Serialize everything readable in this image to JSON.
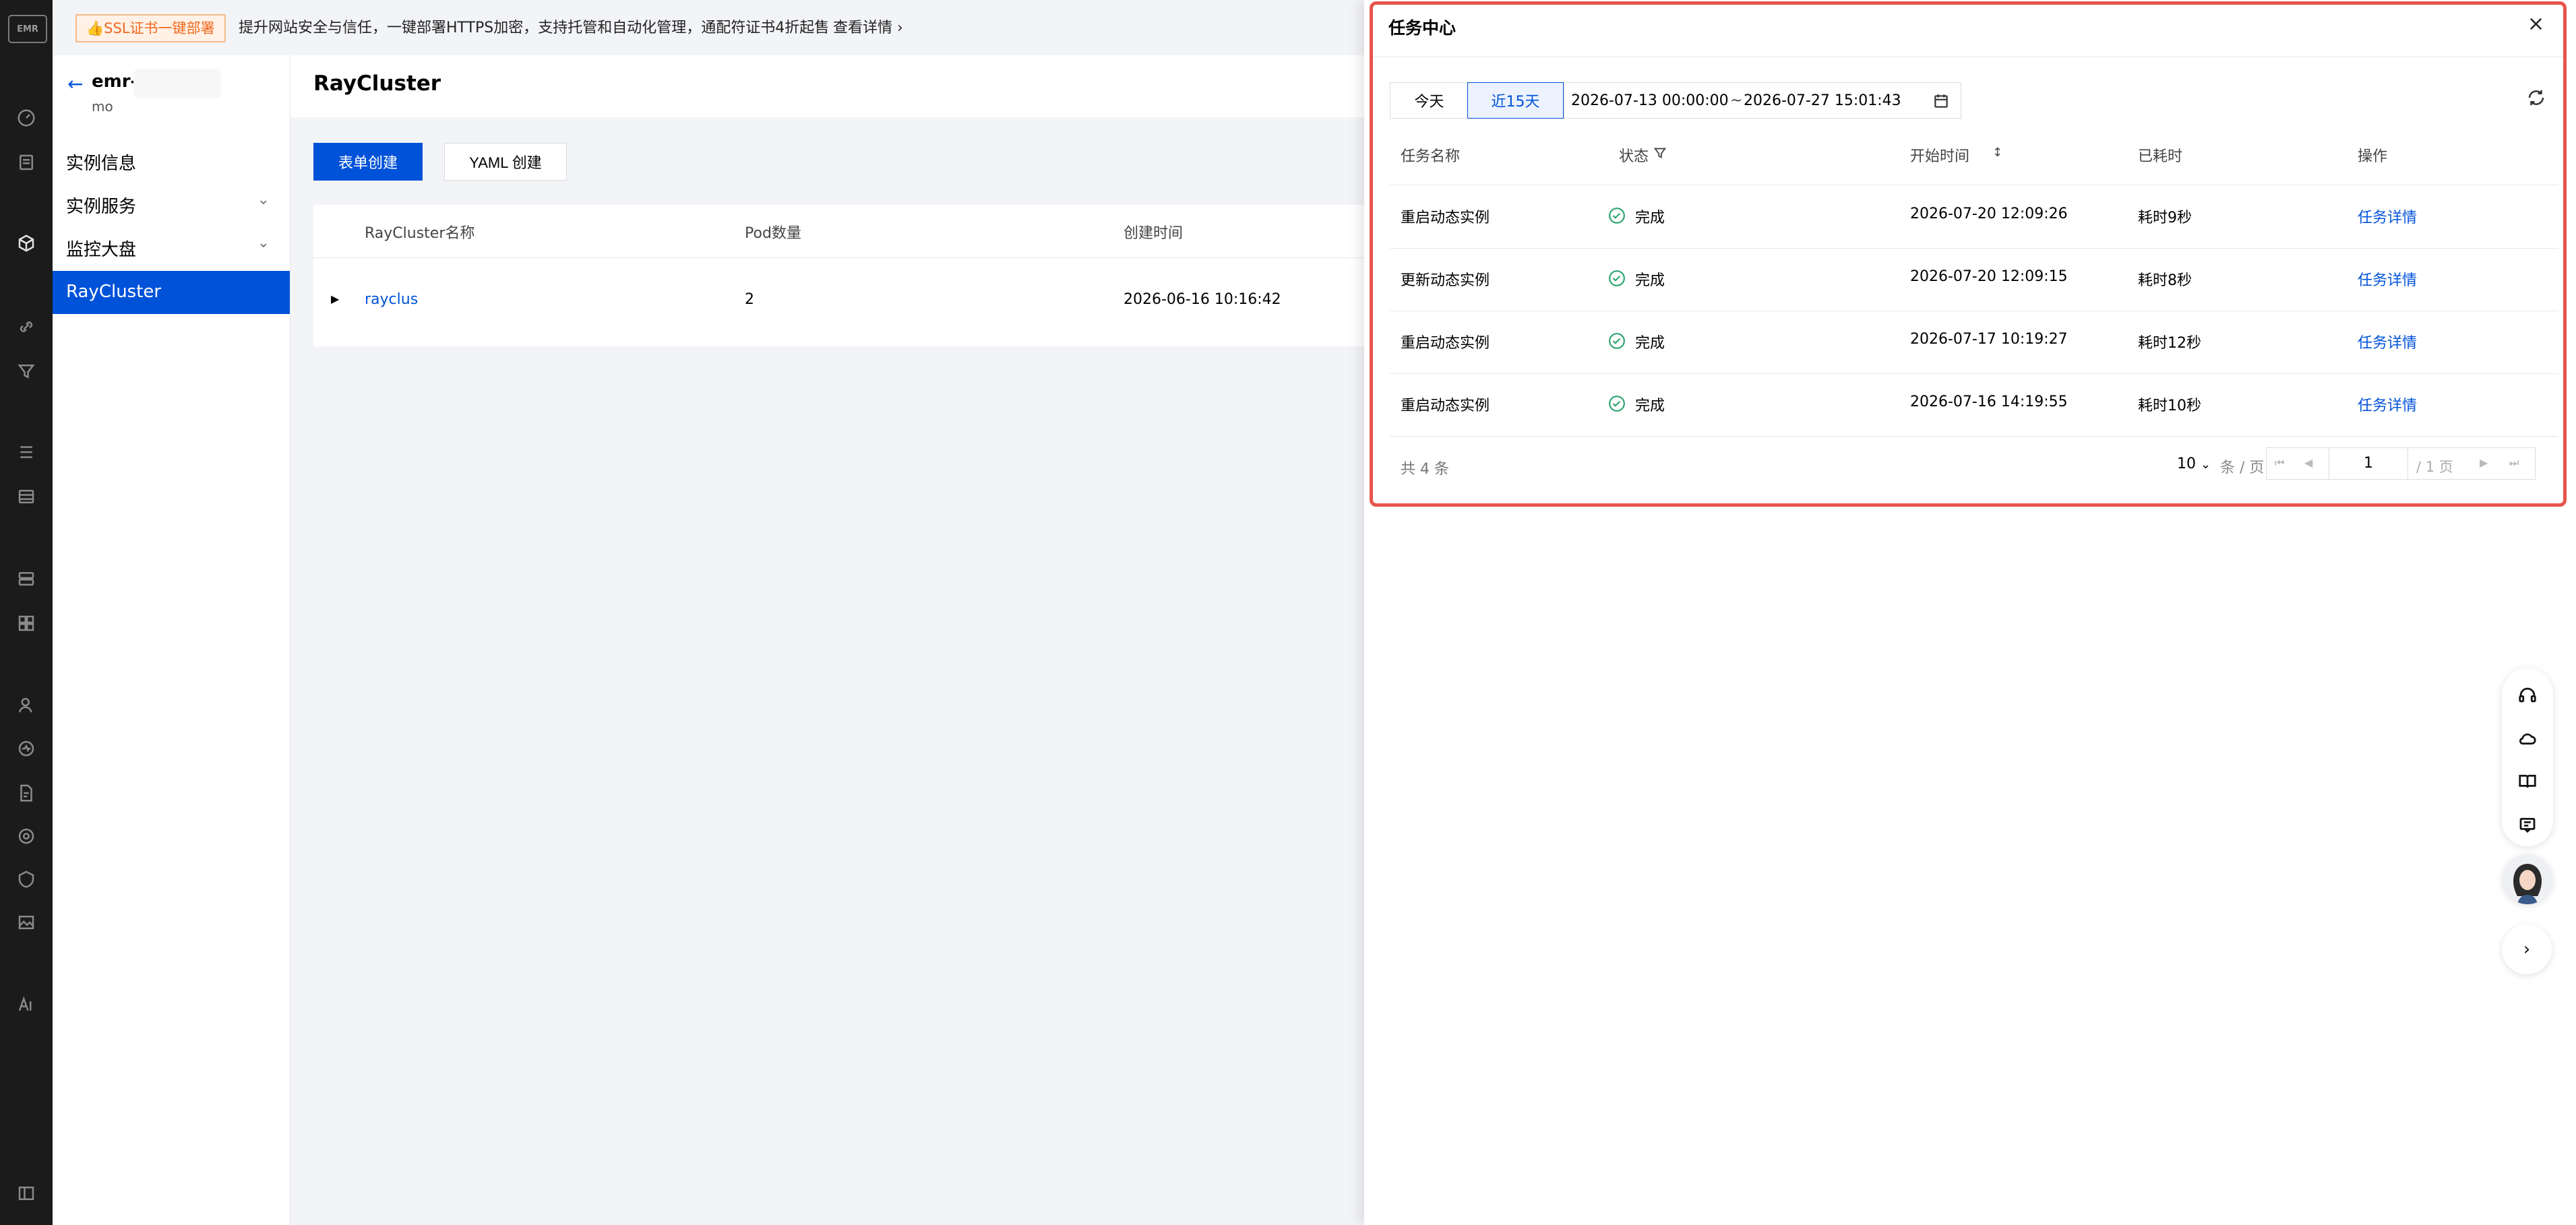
{
  "banner": {
    "tag": "👍SSL证书一键部署",
    "message": "提升网站安全与信任，一键部署HTTPS加密，支持托管和自动化管理，通配符证书4折起售",
    "more": "查看详情 ›"
  },
  "rail": {
    "logo": "EMR",
    "icons": [
      "dashboard-icon",
      "file-icon",
      "cube-icon",
      "link-icon",
      "funnel-icon",
      "list-icon",
      "database-icon",
      "server-icon",
      "apps-icon",
      "user-icon",
      "monitor-icon",
      "document-icon",
      "settings-icon",
      "shield-icon",
      "image-icon",
      "ai-icon",
      "panel-toggle-icon"
    ]
  },
  "sidebar": {
    "instance_name": "emr-",
    "instance_sub": "mo",
    "items": [
      {
        "label": "实例信息"
      },
      {
        "label": "实例服务"
      },
      {
        "label": "监控大盘"
      },
      {
        "label": "RayCluster"
      }
    ]
  },
  "main": {
    "title": "RayCluster",
    "create_form_label": "表单创建",
    "create_yaml_label": "YAML 创建",
    "columns": [
      "RayCluster名称",
      "Pod数量",
      "创建时间"
    ],
    "rows": [
      {
        "name": "rayclus",
        "pods": "2",
        "created": "2026-06-16 10:16:42"
      }
    ]
  },
  "drawer": {
    "title": "任务中心",
    "close": "×",
    "today_label": "今天",
    "last15_label": "近15天",
    "range_start": "2026-07-13 00:00:00",
    "range_sep": "~",
    "range_end": "2026-07-27 15:01:43",
    "columns": {
      "name": "任务名称",
      "status": "状态",
      "start": "开始时间",
      "elapsed": "已耗时",
      "action": "操作"
    },
    "rows": [
      {
        "name": "重启动态实例",
        "status": "完成",
        "start": "2026-07-20 12:09:26",
        "elapsed": "耗时9秒",
        "action": "任务详情"
      },
      {
        "name": "更新动态实例",
        "status": "完成",
        "start": "2026-07-20 12:09:15",
        "elapsed": "耗时8秒",
        "action": "任务详情"
      },
      {
        "name": "重启动态实例",
        "status": "完成",
        "start": "2026-07-17 10:19:27",
        "elapsed": "耗时12秒",
        "action": "任务详情"
      },
      {
        "name": "重启动态实例",
        "status": "完成",
        "start": "2026-07-16 14:19:55",
        "elapsed": "耗时10秒",
        "action": "任务详情"
      }
    ],
    "total": "共 4 条",
    "page_size": "10",
    "page_unit": "条 / 页",
    "current_page": "1",
    "page_total": "/ 1 页"
  },
  "colors": {
    "primary": "#0052d9",
    "success": "#2ba471",
    "highlight_border": "#e8544a",
    "rail_bg": "#1b1b1b"
  }
}
